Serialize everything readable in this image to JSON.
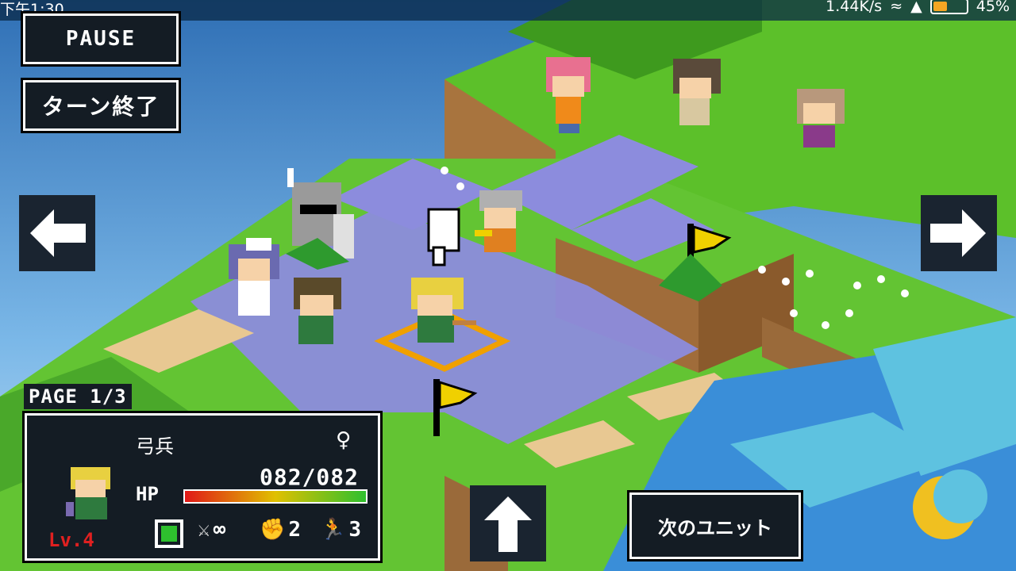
{
  "status_bar": {
    "time": "下午1:30",
    "speed": "1.44K/s",
    "battery": "45%",
    "battery_level": 0.45
  },
  "buttons": {
    "pause": "PAUSE",
    "end_turn": "ターン終了",
    "next_unit": "次のユニット"
  },
  "icons": {
    "left": "arrow-left-icon",
    "right": "arrow-right-icon",
    "up": "arrow-up-icon"
  },
  "unit_panel": {
    "page": "PAGE 1/3",
    "class": "弓兵",
    "gender": "♀",
    "hp_label": "HP",
    "hp": "082/082",
    "hp_fraction": 1.0,
    "level": "Lv.4",
    "weapon_range": "∞",
    "attack": "2",
    "move": "3"
  },
  "colors": {
    "grass": "#5cc02a",
    "dirt": "#9a6a3a",
    "highlight": "#8f8fe0",
    "water": "#3a9ad8",
    "flag": "#f0d000",
    "cursor": "#f0a000"
  }
}
